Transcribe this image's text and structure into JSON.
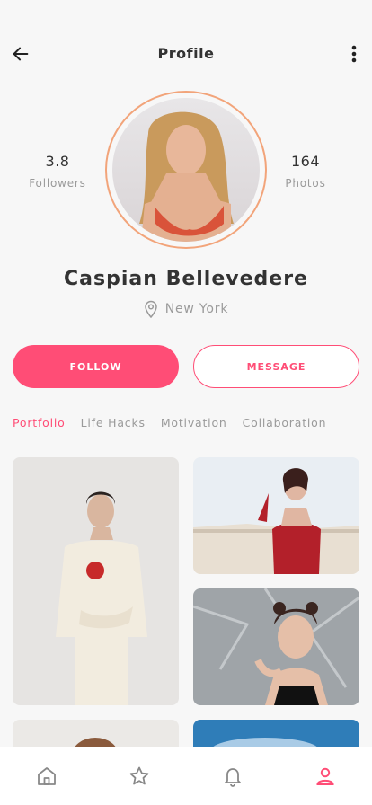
{
  "header": {
    "title": "Profile"
  },
  "stats": {
    "followers": {
      "value": "3.8",
      "label": "Followers"
    },
    "photos": {
      "value": "164",
      "label": "Photos"
    }
  },
  "profile": {
    "name": "Caspian Bellevedere",
    "location": "New York"
  },
  "actions": {
    "follow_label": "FOLLOW",
    "message_label": "MESSAGE"
  },
  "tabs": [
    {
      "label": "Portfolio",
      "active": true
    },
    {
      "label": "Life Hacks"
    },
    {
      "label": "Motivation"
    },
    {
      "label": "Collaboration"
    }
  ],
  "colors": {
    "accent": "#ff4d76",
    "ring": "#f2a47a",
    "muted": "#9a9a9a",
    "text": "#333333"
  },
  "nav": {
    "items": [
      "home-icon",
      "star-icon",
      "bell-icon",
      "user-icon"
    ],
    "active": "user-icon"
  }
}
